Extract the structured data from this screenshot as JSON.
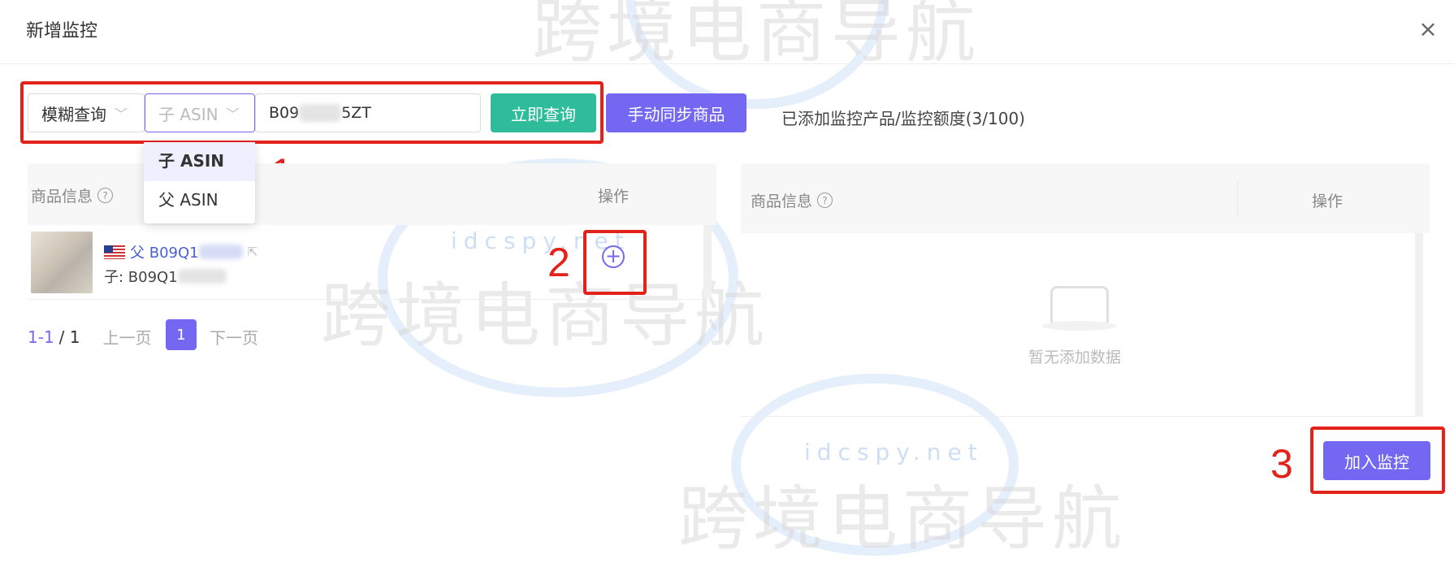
{
  "dialog": {
    "title": "新增监控",
    "close_icon": "close-icon"
  },
  "search": {
    "mode_select": "模糊查询",
    "type_select": "子 ASIN",
    "input_value": "B09",
    "input_value_tail": "5ZT",
    "query_button": "立即查询",
    "sync_button": "手动同步商品",
    "quota_text": "已添加监控产品/监控额度(3/100)",
    "type_options": [
      "子 ASIN",
      "父 ASIN"
    ]
  },
  "left_table": {
    "headers": [
      "商品信息",
      "操作"
    ],
    "rows": [
      {
        "flag_icon": "us-flag-icon",
        "parent_label": "父 B09Q1",
        "child_label": "子: B09Q1",
        "add_icon": "plus-circle-icon"
      }
    ],
    "pagination": {
      "range": "1-1",
      "total": "/ 1",
      "prev": "上一页",
      "page": "1",
      "next": "下一页"
    }
  },
  "right_table": {
    "headers": [
      "商品信息",
      "操作"
    ],
    "empty_text": "暂无添加数据"
  },
  "footer": {
    "add_monitor_button": "加入监控"
  },
  "annotations": [
    "1",
    "2",
    "3"
  ],
  "watermark": {
    "text": "跨境电商导航",
    "url": "idcspy.net"
  },
  "colors": {
    "accent_purple": "#7468f3",
    "accent_green": "#2ebc9b",
    "annotation_red": "#e3231a"
  }
}
